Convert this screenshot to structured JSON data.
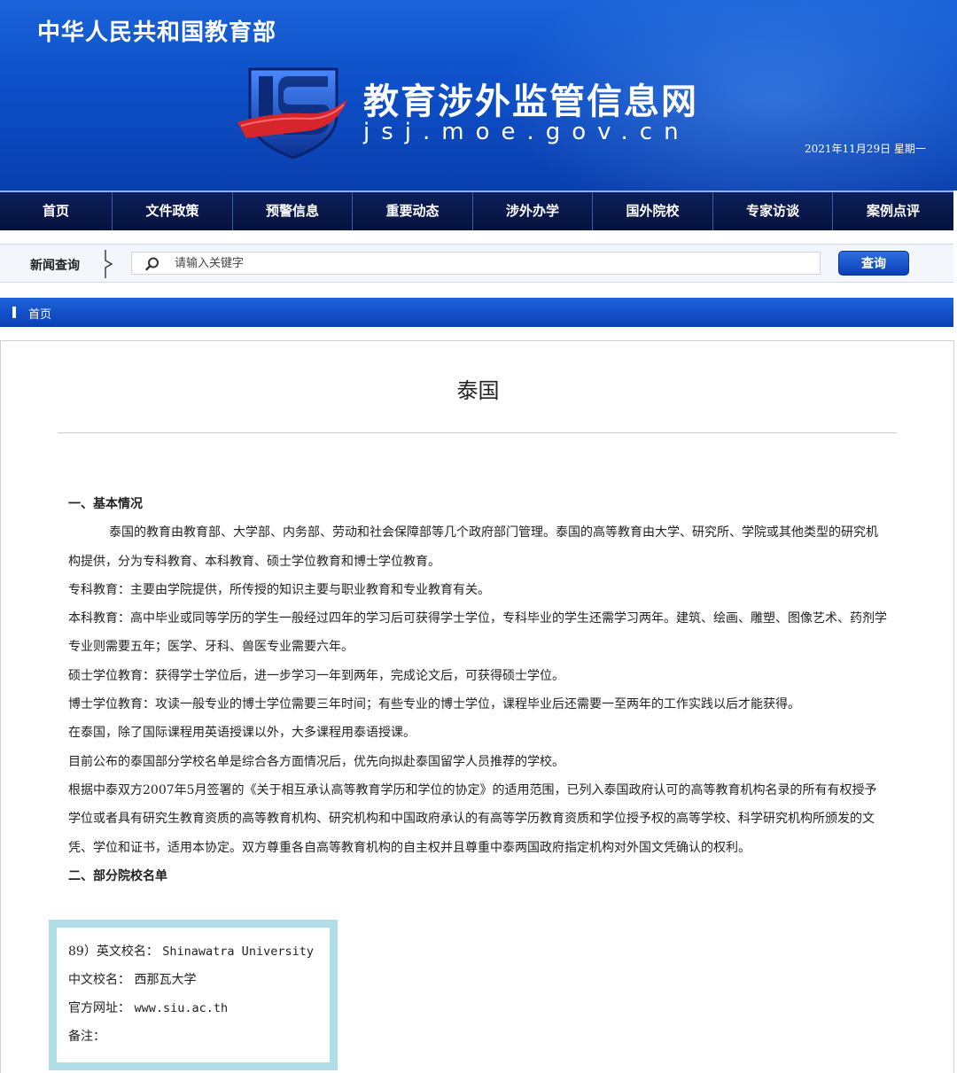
{
  "header": {
    "ministry": "中华人民共和国教育部",
    "site_name": "教育涉外监管信息网",
    "site_domain": "jsj.moe.gov.cn",
    "date": "2021年11月29日  星期一"
  },
  "nav": {
    "items": [
      {
        "label": "首页"
      },
      {
        "label": "文件政策"
      },
      {
        "label": "预警信息"
      },
      {
        "label": "重要动态"
      },
      {
        "label": "涉外办学"
      },
      {
        "label": "国外院校"
      },
      {
        "label": "专家访谈"
      },
      {
        "label": "案例点评"
      }
    ]
  },
  "search": {
    "label": "新闻查询",
    "placeholder": "请输入关键字",
    "button": "查询"
  },
  "breadcrumb": {
    "home": "首页"
  },
  "article": {
    "title": "泰国",
    "sections": [
      {
        "heading": "一、基本情况"
      },
      {
        "p1": "泰国的教育由教育部、大学部、内务部、劳动和社会保障部等几个政府部门管理。泰国的高等教育由大学、研究所、学院或其他类型的研究机构提供，分为专科教育、本科教育、硕士学位教育和博士学位教育。"
      },
      {
        "p2": "专科教育：主要由学院提供，所传授的知识主要与职业教育和专业教育有关。"
      },
      {
        "p3": "本科教育：高中毕业或同等学历的学生一般经过四年的学习后可获得学士学位，专科毕业的学生还需学习两年。建筑、绘画、雕塑、图像艺术、药剂学专业则需要五年；医学、牙科、兽医专业需要六年。"
      },
      {
        "p4": "硕士学位教育：获得学士学位后，进一步学习一年到两年，完成论文后，可获得硕士学位。"
      },
      {
        "p5": "博士学位教育：攻读一般专业的博士学位需要三年时间；有些专业的博士学位，课程毕业后还需要一至两年的工作实践以后才能获得。"
      },
      {
        "p6": "在泰国，除了国际课程用英语授课以外，大多课程用泰语授课。"
      },
      {
        "p7": "目前公布的泰国部分学校名单是综合各方面情况后，优先向拟赴泰国留学人员推荐的学校。"
      },
      {
        "p8": "根据中泰双方2007年5月签署的《关于相互承认高等教育学历和学位的协定》的适用范围，已列入泰国政府认可的高等教育机构名录的所有有权授予学位或者具有研究生教育资质的高等教育机构、研究机构和中国政府承认的有高等学历教育资质和学位授予权的高等学校、科学研究机构所颁发的文凭、学位和证书，适用本协定。双方尊重各自高等教育机构的自主权并且尊重中泰两国政府指定机构对外国文凭确认的权利。"
      },
      {
        "heading2": "二、部分院校名单"
      }
    ]
  },
  "school": {
    "en_label": "89）英文校名：",
    "en_name": "Shinawatra University",
    "cn_label": "中文校名：",
    "cn_name": "西那瓦大学",
    "url_label": "官方网址：",
    "url": "www.siu.ac.th",
    "note_label": "备注："
  },
  "colors": {
    "banner_blue": "#0d4fc8",
    "nav_dark": "#06123c",
    "box_border": "#b0dde6",
    "shield_red": "#d7262b"
  }
}
